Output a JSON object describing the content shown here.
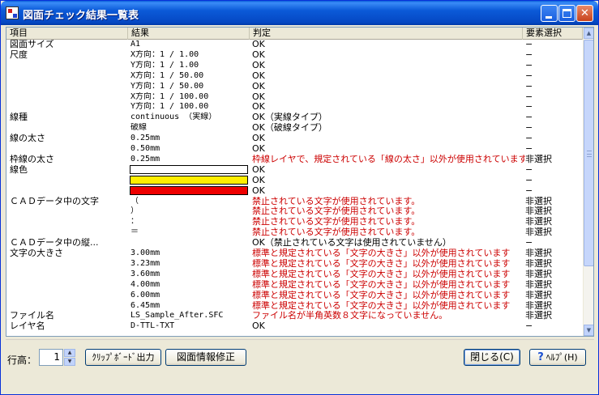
{
  "window": {
    "title": "図面チェック結果一覧表"
  },
  "columns": {
    "item": "項目",
    "result": "結果",
    "judgement": "判定",
    "selection": "要素選択"
  },
  "rows": [
    {
      "item": "図面サイズ",
      "result": "A1",
      "judgement": "OK",
      "selection": "−"
    },
    {
      "item": "尺度",
      "result": "X方向：1 / 1.00",
      "judgement": "OK",
      "selection": "−"
    },
    {
      "item": "",
      "result": "Y方向：1 / 1.00",
      "judgement": "OK",
      "selection": "−"
    },
    {
      "item": "",
      "result": "X方向：1 / 50.00",
      "judgement": "OK",
      "selection": "−"
    },
    {
      "item": "",
      "result": "Y方向：1 / 50.00",
      "judgement": "OK",
      "selection": "−"
    },
    {
      "item": "",
      "result": "X方向：1 / 100.00",
      "judgement": "OK",
      "selection": "−"
    },
    {
      "item": "",
      "result": "Y方向：1 / 100.00",
      "judgement": "OK",
      "selection": "−"
    },
    {
      "item": "線種",
      "result": "continuous （実線）",
      "judgement": "OK（実線タイプ）",
      "selection": "−"
    },
    {
      "item": "",
      "result": "破線",
      "judgement": "OK（破線タイプ）",
      "selection": "−"
    },
    {
      "item": "線の太さ",
      "result": "0.25mm",
      "judgement": "OK",
      "selection": "−"
    },
    {
      "item": "",
      "result": "0.50mm",
      "judgement": "OK",
      "selection": "−"
    },
    {
      "item": "枠線の太さ",
      "result": "0.25mm",
      "judgement": "枠線レイヤで、規定されている「線の太さ」以外が使用されています",
      "selection": "非選択",
      "error": true
    },
    {
      "item": "線色",
      "swatch": "#ffffff",
      "judgement": "OK",
      "selection": "−"
    },
    {
      "item": "",
      "swatch": "#ffee00",
      "judgement": "OK",
      "selection": "−"
    },
    {
      "item": "",
      "swatch": "#ee0000",
      "judgement": "OK",
      "selection": "−"
    },
    {
      "item": "ＣＡＤデータ中の文字",
      "result": "（",
      "judgement": "禁止されている文字が使用されています。",
      "selection": "非選択",
      "error": true
    },
    {
      "item": "",
      "result": "）",
      "judgement": "禁止されている文字が使用されています。",
      "selection": "非選択",
      "error": true
    },
    {
      "item": "",
      "result": "：",
      "judgement": "禁止されている文字が使用されています。",
      "selection": "非選択",
      "error": true
    },
    {
      "item": "",
      "result": "＝",
      "judgement": "禁止されている文字が使用されています。",
      "selection": "非選択",
      "error": true
    },
    {
      "item": "ＣＡＤデータ中の縦...",
      "result": "",
      "judgement": "OK（禁止されている文字は使用されていません）",
      "selection": "−"
    },
    {
      "item": "文字の大きさ",
      "result": "3.00mm",
      "judgement": "標準と規定されている「文字の大きさ」以外が使用されています",
      "selection": "非選択",
      "error": true
    },
    {
      "item": "",
      "result": "3.23mm",
      "judgement": "標準と規定されている「文字の大きさ」以外が使用されています",
      "selection": "非選択",
      "error": true
    },
    {
      "item": "",
      "result": "3.60mm",
      "judgement": "標準と規定されている「文字の大きさ」以外が使用されています",
      "selection": "非選択",
      "error": true
    },
    {
      "item": "",
      "result": "4.00mm",
      "judgement": "標準と規定されている「文字の大きさ」以外が使用されています",
      "selection": "非選択",
      "error": true
    },
    {
      "item": "",
      "result": "6.00mm",
      "judgement": "標準と規定されている「文字の大きさ」以外が使用されています",
      "selection": "非選択",
      "error": true
    },
    {
      "item": "",
      "result": "6.45mm",
      "judgement": "標準と規定されている「文字の大きさ」以外が使用されています",
      "selection": "非選択",
      "error": true
    },
    {
      "item": "ファイル名",
      "result": "LS_Sample_After.SFC",
      "judgement": "ファイル名が半角英数８文字になっていません。",
      "selection": "非選択",
      "error": true
    },
    {
      "item": "レイヤ名",
      "result": "D-TTL-TXT",
      "judgement": "OK",
      "selection": "−"
    }
  ],
  "footer": {
    "row_height_label": "行高：",
    "row_height_value": "1",
    "clipboard_button": "ｸﾘｯﾌﾟﾎﾞｰﾄﾞ出力",
    "drawing_info_button": "図面情報修正",
    "close_button": "閉じる(C)",
    "help_button": "ﾍﾙﾌﾟ(H)"
  },
  "colors": {
    "error_text": "#cc0000",
    "title_bar": "#0548c4"
  }
}
